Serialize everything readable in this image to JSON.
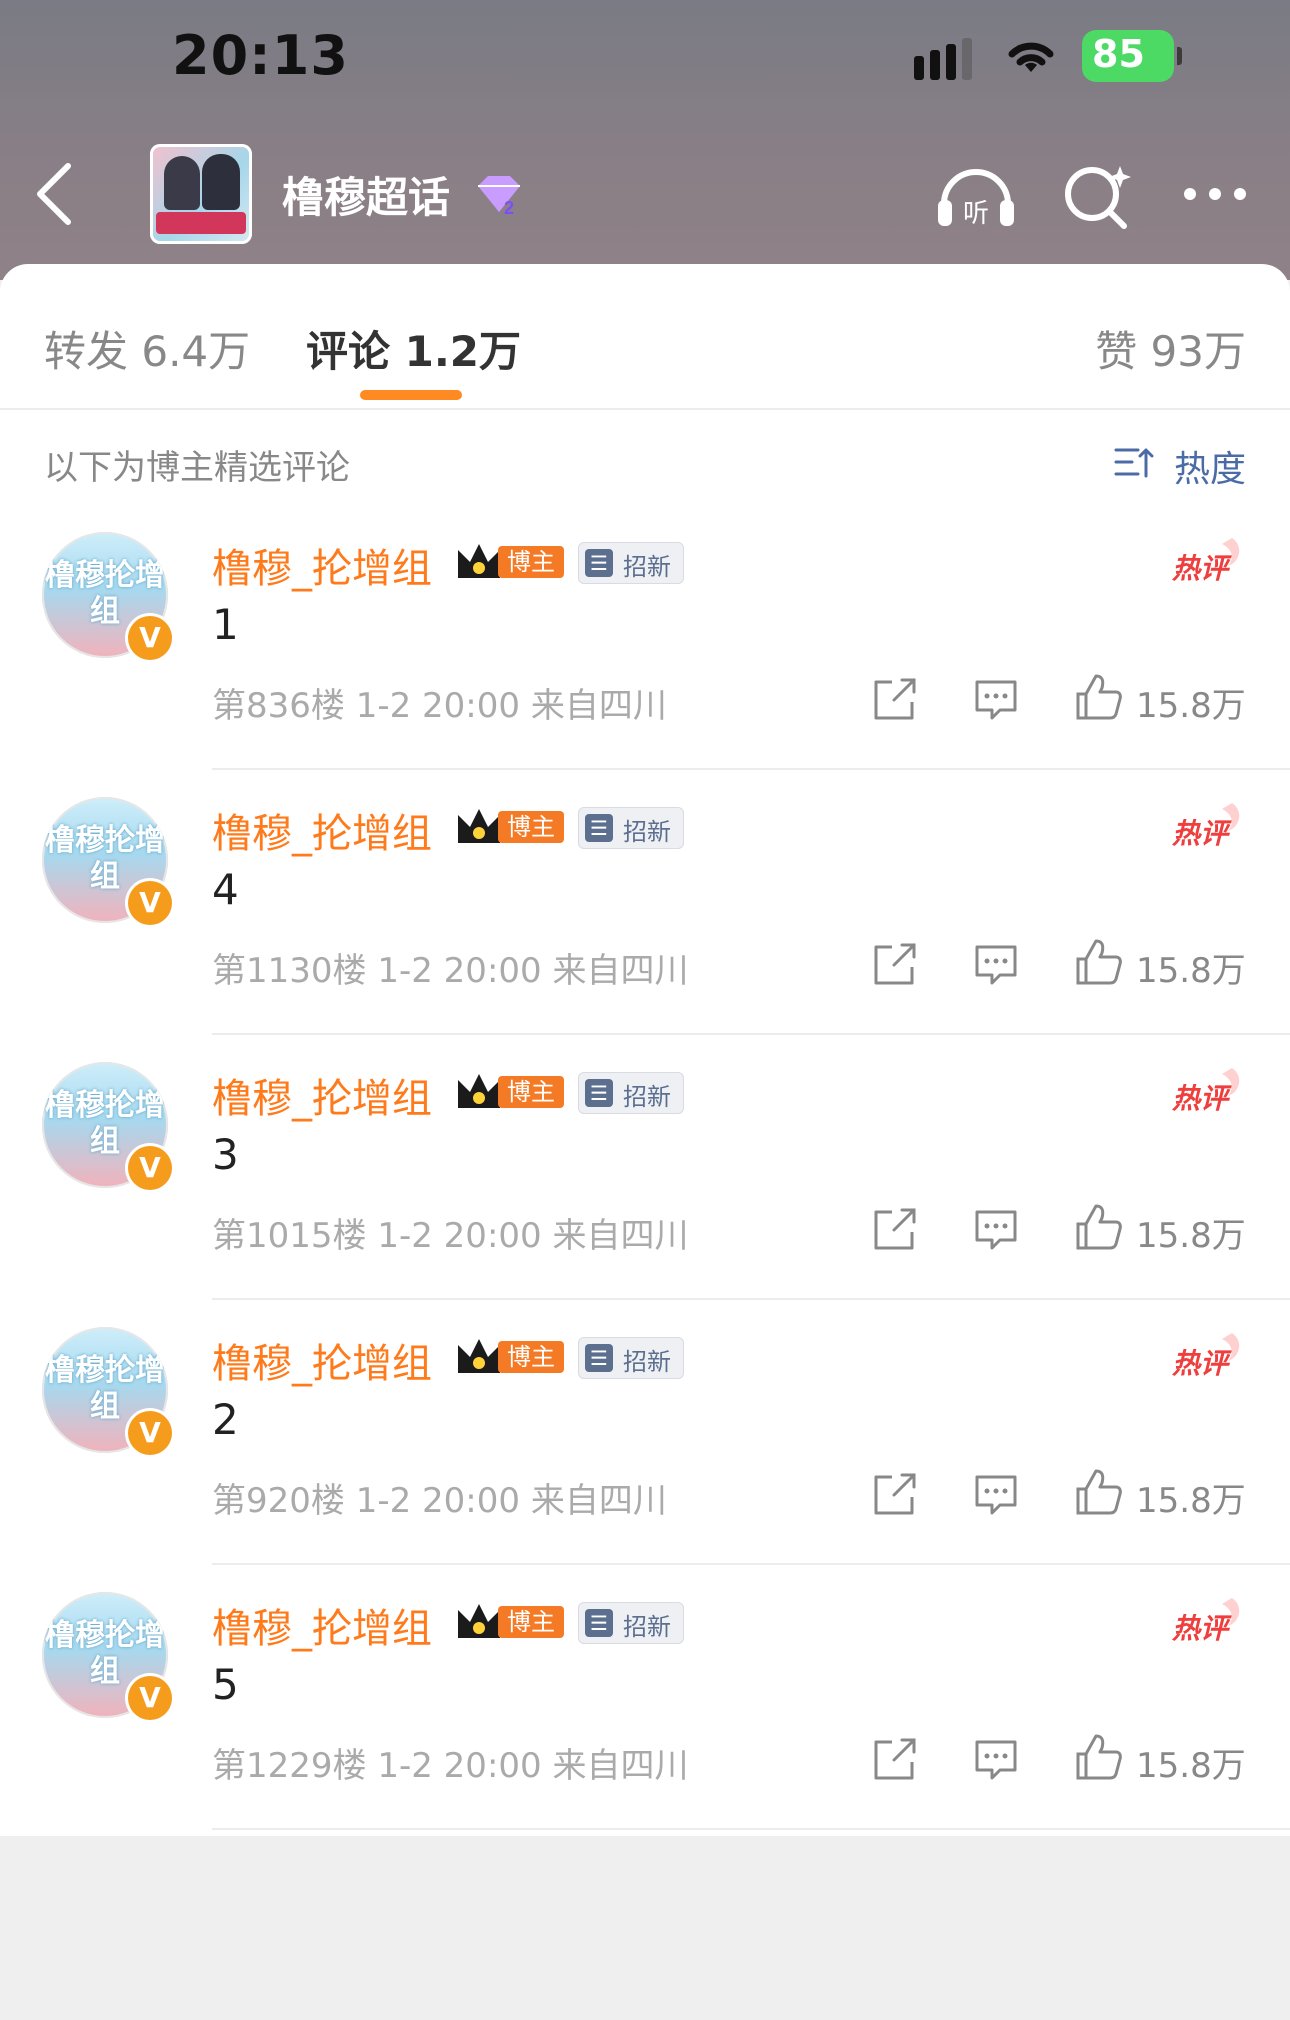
{
  "status_bar": {
    "time": "20:13",
    "battery": "85"
  },
  "header": {
    "topic_title": "橹穆超话",
    "vip_level": "2",
    "listen_label": "听"
  },
  "tabs": {
    "repost": "转发 6.4万",
    "comments": "评论 1.2万",
    "likes": "赞 93万"
  },
  "featured_label": "以下为博主精选评论",
  "sort_label": "热度",
  "avatar_text": "橹穆抡增组",
  "comments": [
    {
      "username": "橹穆_抡增组",
      "host_label": "博主",
      "recruit_label": "招新",
      "hot_label": "热评",
      "text": "1",
      "meta": "第836楼 1-2 20:00 来自四川",
      "likes": "15.8万"
    },
    {
      "username": "橹穆_抡增组",
      "host_label": "博主",
      "recruit_label": "招新",
      "hot_label": "热评",
      "text": "4",
      "meta": "第1130楼 1-2 20:00 来自四川",
      "likes": "15.8万"
    },
    {
      "username": "橹穆_抡增组",
      "host_label": "博主",
      "recruit_label": "招新",
      "hot_label": "热评",
      "text": "3",
      "meta": "第1015楼 1-2 20:00 来自四川",
      "likes": "15.8万"
    },
    {
      "username": "橹穆_抡增组",
      "host_label": "博主",
      "recruit_label": "招新",
      "hot_label": "热评",
      "text": "2",
      "meta": "第920楼 1-2 20:00 来自四川",
      "likes": "15.8万"
    },
    {
      "username": "橹穆_抡增组",
      "host_label": "博主",
      "recruit_label": "招新",
      "hot_label": "热评",
      "text": "5",
      "meta": "第1229楼 1-2 20:00 来自四川",
      "likes": "15.8万"
    }
  ],
  "icons": [
    "back-icon",
    "listen-icon",
    "search-icon",
    "more-icon",
    "sort-icon",
    "share-icon",
    "reply-icon",
    "like-icon"
  ],
  "colors": {
    "accent": "#ff7a1a",
    "tab_indicator": "#ff8a21",
    "link_blue": "#4b6ba6",
    "battery_green": "#4cd964"
  }
}
